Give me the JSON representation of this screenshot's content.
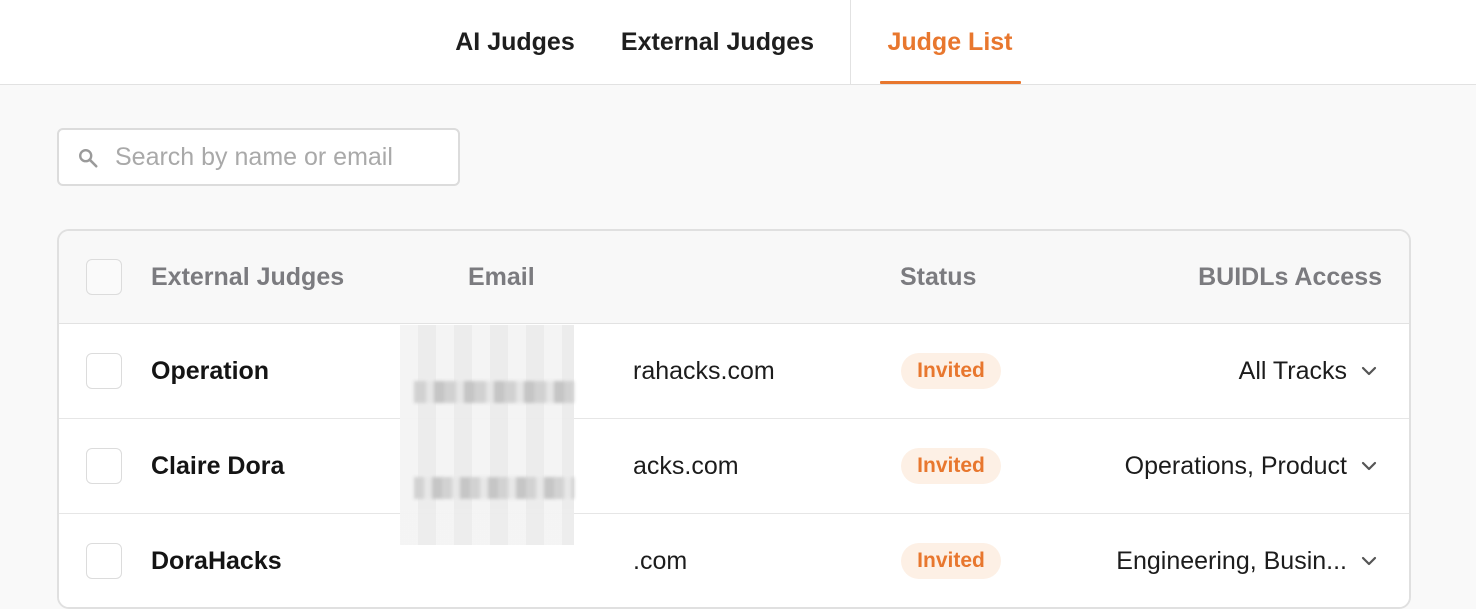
{
  "tabs": [
    {
      "label": "AI Judges",
      "active": false
    },
    {
      "label": "External Judges",
      "active": false
    },
    {
      "label": "Judge List",
      "active": true
    }
  ],
  "search": {
    "placeholder": "Search by name or email",
    "value": ""
  },
  "table": {
    "headers": {
      "judges": "External Judges",
      "email": "Email",
      "status": "Status",
      "access": "BUIDLs Access"
    },
    "rows": [
      {
        "name": "Operation",
        "email": "rahacks.com",
        "status": "Invited",
        "access": "All Tracks"
      },
      {
        "name": "Claire Dora",
        "email": "acks.com",
        "status": "Invited",
        "access": "Operations, Product"
      },
      {
        "name": "DoraHacks",
        "email": ".com",
        "status": "Invited",
        "access": "Engineering, Busin..."
      }
    ]
  },
  "colors": {
    "accent": "#e8772e",
    "badge_bg": "#fdf0e5",
    "header_text": "#7b7b7f"
  },
  "icons": {
    "search": "search-icon",
    "expand": "chevron-down-icon"
  }
}
